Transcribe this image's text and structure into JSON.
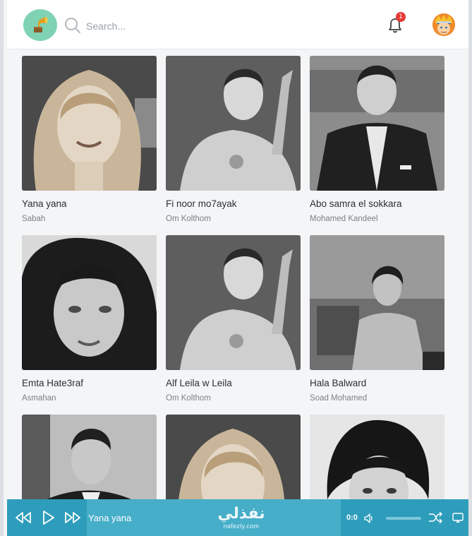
{
  "header": {
    "search_placeholder": "Search...",
    "notification_count": "1"
  },
  "songs": [
    {
      "title": "Yana yana",
      "artist": "Sabah"
    },
    {
      "title": "Fi noor mo7ayak",
      "artist": "Om Kolthom"
    },
    {
      "title": "Abo samra el sokkara",
      "artist": "Mohamed Kandeel"
    },
    {
      "title": "Emta Hate3raf",
      "artist": "Asmahan"
    },
    {
      "title": "Alf Leila w Leila",
      "artist": "Om Kolthom"
    },
    {
      "title": "Hala Balward",
      "artist": "Soad Mohamed"
    },
    {
      "title": "",
      "artist": ""
    },
    {
      "title": "",
      "artist": ""
    },
    {
      "title": "",
      "artist": ""
    }
  ],
  "player": {
    "now_playing": "Yana yana",
    "brand_arabic": "نفذلي",
    "brand_latin": "nafezly.com",
    "time": "0:0",
    "progress": 0
  },
  "colors": {
    "player_bg": "#46aec8",
    "player_dark": "#2e9dbb",
    "logo_bg": "#7fd3b4",
    "badge": "#e53935"
  },
  "icons": {
    "logo": "gramophone-icon",
    "search": "search-icon",
    "notifications": "bell-icon",
    "prev": "rewind-icon",
    "play": "play-icon",
    "next": "fast-forward-icon",
    "volume": "speaker-icon",
    "shuffle": "shuffle-icon",
    "cast": "cast-icon"
  }
}
